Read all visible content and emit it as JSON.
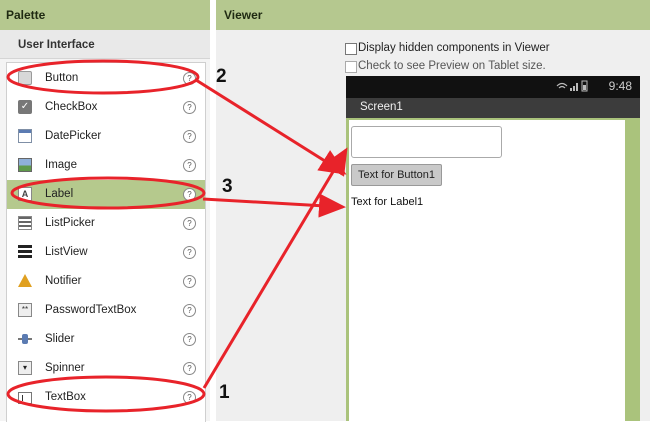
{
  "palette": {
    "title": "Palette",
    "section": "User Interface",
    "items": [
      {
        "label": "Button",
        "icon": "button-icon"
      },
      {
        "label": "CheckBox",
        "icon": "checkbox-icon"
      },
      {
        "label": "DatePicker",
        "icon": "datepicker-icon"
      },
      {
        "label": "Image",
        "icon": "image-icon"
      },
      {
        "label": "Label",
        "icon": "label-icon",
        "selected": true
      },
      {
        "label": "ListPicker",
        "icon": "listpicker-icon"
      },
      {
        "label": "ListView",
        "icon": "listview-icon"
      },
      {
        "label": "Notifier",
        "icon": "notifier-icon"
      },
      {
        "label": "PasswordTextBox",
        "icon": "passwordtextbox-icon"
      },
      {
        "label": "Slider",
        "icon": "slider-icon"
      },
      {
        "label": "Spinner",
        "icon": "spinner-icon"
      },
      {
        "label": "TextBox",
        "icon": "textbox-icon"
      }
    ],
    "help_glyph": "?"
  },
  "viewer": {
    "title": "Viewer",
    "option_hidden": "Display hidden components in Viewer",
    "option_tablet": "Check to see Preview on Tablet size.",
    "status_time": "9:48",
    "screen_title": "Screen1",
    "button_text": "Text for Button1",
    "label_text": "Text for Label1"
  },
  "annotations": {
    "numbers": [
      "2",
      "3",
      "1"
    ],
    "color": "#e8232a"
  },
  "colors": {
    "header_bg": "#b5c88f",
    "selected_bg": "#b5c98d",
    "phone_frame": "#aac37c"
  }
}
